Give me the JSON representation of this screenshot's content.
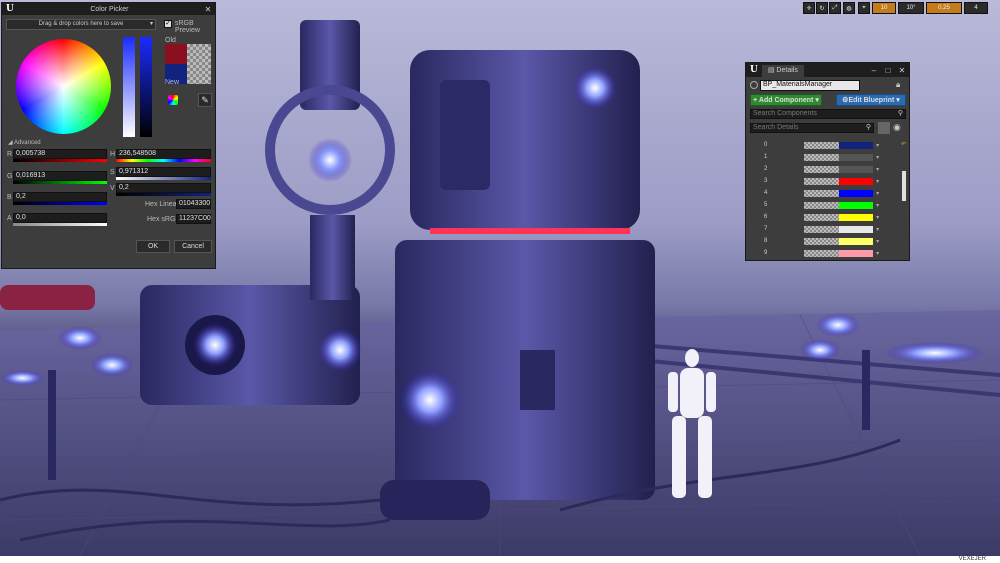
{
  "viewport_toolbar": {
    "grid_snap": "10",
    "rotation_snap": "10°",
    "scale_snap": "0,25",
    "camera_speed": "4"
  },
  "color_picker": {
    "title": "Color Picker",
    "dropdown_label": "Drag & drop colors here to save",
    "srgb_preview_label": "sRGB Preview",
    "old_label": "Old",
    "new_label": "New",
    "advanced_label": "Advanced",
    "channels": [
      {
        "label": "R",
        "value": "0,005738"
      },
      {
        "label": "G",
        "value": "0,016913"
      },
      {
        "label": "B",
        "value": "0,2"
      },
      {
        "label": "A",
        "value": "0,0"
      }
    ],
    "hsv": [
      {
        "label": "H",
        "value": "236,548508"
      },
      {
        "label": "S",
        "value": "0,971312"
      },
      {
        "label": "V",
        "value": "0,2"
      }
    ],
    "hex_linear_label": "Hex Linear",
    "hex_linear_value": "01043300",
    "hex_srgb_label": "Hex sRGB",
    "hex_srgb_value": "11237C00",
    "ok_label": "OK",
    "cancel_label": "Cancel",
    "old_color": "#8a1020",
    "new_color": "#11237c"
  },
  "details": {
    "tab_label": "Details",
    "actor_name": "BP_MaterialsManager",
    "add_component_label": "+ Add Component",
    "edit_blueprint_label": "Edit Blueprint",
    "search_components_placeholder": "Search Components",
    "search_details_placeholder": "Search Details",
    "rows": [
      {
        "index": "0",
        "color": "#11237c"
      },
      {
        "index": "1",
        "color": "#555555"
      },
      {
        "index": "2",
        "color": "#555555"
      },
      {
        "index": "3",
        "color": "#ff0000"
      },
      {
        "index": "4",
        "color": "#0000ff"
      },
      {
        "index": "5",
        "color": "#00ff00"
      },
      {
        "index": "6",
        "color": "#ffff00"
      },
      {
        "index": "7",
        "color": "#e8e8e8"
      },
      {
        "index": "8",
        "color": "#ffff66"
      },
      {
        "index": "9",
        "color": "#ff9aa8"
      }
    ]
  },
  "watermark": "VEXEJER"
}
